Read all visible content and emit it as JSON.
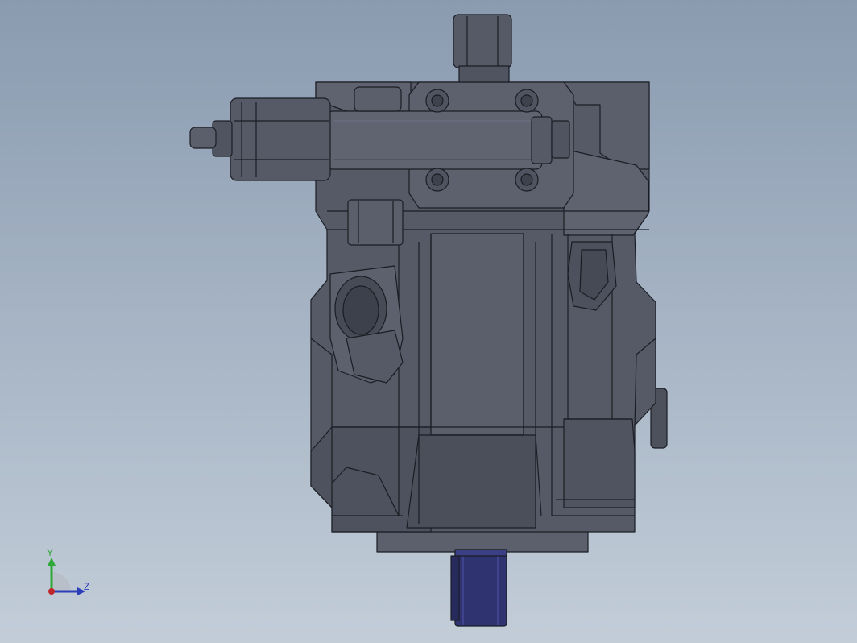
{
  "viewport": {
    "background_top": "#8a9bb0",
    "background_bottom": "#c2cdd8"
  },
  "model": {
    "body_color": "#555a66",
    "edge_color": "#1b1d24",
    "highlight_color": "#6c7282",
    "shaft_color": "#2f3370"
  },
  "triad": {
    "y_label": "Y",
    "z_label": "Z",
    "y_color": "#2fa83a",
    "z_color": "#2d3fb8",
    "x_color": "#c0262b"
  }
}
